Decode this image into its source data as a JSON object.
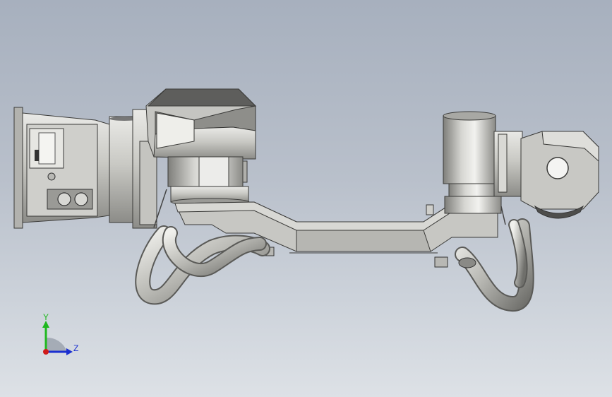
{
  "viewport": {
    "background_top": "#a7b0be",
    "background_bottom": "#dde1e6"
  },
  "triad": {
    "y_label": "Y",
    "z_label": "Z",
    "y_color": "#1fb81f",
    "z_color": "#1a2fd0",
    "x_color": "#d01a1a"
  }
}
